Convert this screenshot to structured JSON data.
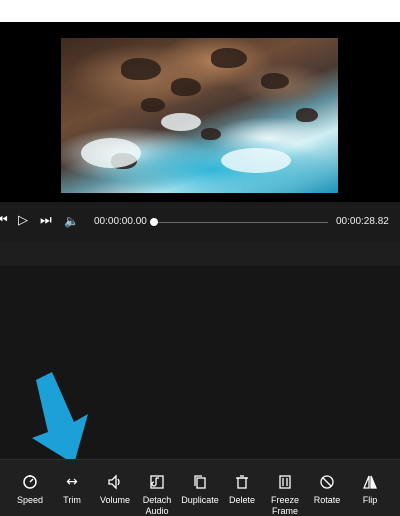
{
  "player": {
    "current_time": "00:00:00.00",
    "total_time": "00:00:28.82",
    "progress": 0.0
  },
  "toolbar": {
    "tools": [
      {
        "label": "Speed",
        "icon": "speed-icon"
      },
      {
        "label": "Trim",
        "icon": "trim-icon"
      },
      {
        "label": "Volume",
        "icon": "volume-icon"
      },
      {
        "label": "Detach\nAudio",
        "icon": "detach-audio-icon"
      },
      {
        "label": "Duplicate",
        "icon": "duplicate-icon"
      },
      {
        "label": "Delete",
        "icon": "delete-icon"
      },
      {
        "label": "Freeze\nFrame",
        "icon": "freeze-frame-icon"
      },
      {
        "label": "Rotate",
        "icon": "rotate-icon"
      },
      {
        "label": "Flip",
        "icon": "flip-icon"
      }
    ]
  },
  "colors": {
    "annotation_arrow": "#1da0d8",
    "toolbar_bg": "#202020",
    "timeline_bg": "#161616"
  }
}
